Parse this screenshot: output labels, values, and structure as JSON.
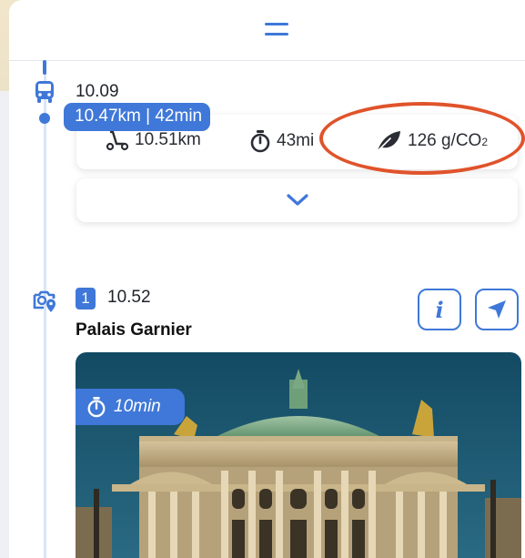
{
  "bus_segment": {
    "time": "10.09",
    "route_summary": "10.47km | 42min",
    "distance": "10.51km",
    "duration": "43mi",
    "co2_number": "126 g/CO",
    "co2_subscript": "2"
  },
  "stop": {
    "step_number": "1",
    "time": "10.52",
    "name": "Palais Garnier",
    "visit_duration": "10min"
  },
  "colors": {
    "accent": "#3f78d8",
    "highlight": "#e0532b",
    "timeline": "#d9e6f7"
  },
  "icons": {
    "drag": "drag-handle-icon",
    "bus": "bus-icon",
    "distance": "scooter-icon",
    "duration": "stopwatch-icon",
    "co2": "leaf-icon",
    "expand": "chevron-down-icon",
    "poi": "camera-location-icon",
    "info": "info-icon",
    "navigate": "navigation-arrow-icon"
  }
}
